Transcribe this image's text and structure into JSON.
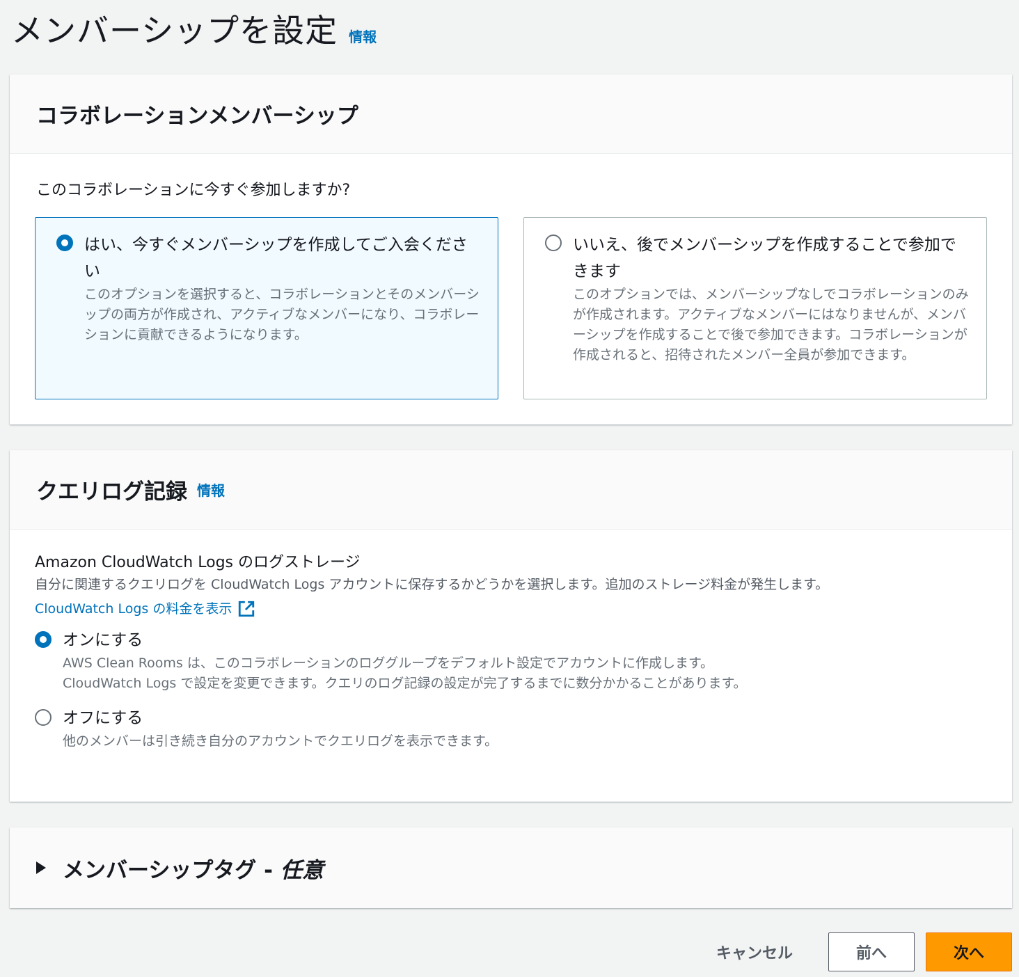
{
  "page": {
    "title": "メンバーシップを設定",
    "info": "情報"
  },
  "membership": {
    "title": "コラボレーションメンバーシップ",
    "question": "このコラボレーションに今すぐ参加しますか?",
    "options": [
      {
        "label": "はい、今すぐメンバーシップを作成してご入会ください",
        "description": "このオプションを選択すると、コラボレーションとそのメンバーシップの両方が作成され、アクティブなメンバーになり、コラボレーションに貢献できるようになります。",
        "selected": true
      },
      {
        "label": "いいえ、後でメンバーシップを作成することで参加できます",
        "description": "このオプションでは、メンバーシップなしでコラボレーションのみが作成されます。アクティブなメンバーにはなりませんが、メンバーシップを作成することで後で参加できます。コラボレーションが作成されると、招待されたメンバー全員が参加できます。",
        "selected": false
      }
    ]
  },
  "query_logging": {
    "title": "クエリログ記録",
    "info": "情報",
    "field_label": "Amazon CloudWatch Logs のログストレージ",
    "field_description": "自分に関連するクエリログを CloudWatch Logs アカウントに保存するかどうかを選択します。追加のストレージ料金が発生します。",
    "pricing_link": "CloudWatch Logs の料金を表示",
    "options": [
      {
        "label": "オンにする",
        "description": "AWS Clean Rooms は、このコラボレーションのロググループをデフォルト設定でアカウントに作成します。CloudWatch Logs で設定を変更できます。クエリのログ記録の設定が完了するまでに数分かかることがあります。",
        "selected": true
      },
      {
        "label": "オフにする",
        "description": "他のメンバーは引き続き自分のアカウントでクエリログを表示できます。",
        "selected": false
      }
    ]
  },
  "tags": {
    "title": "メンバーシップタグ - ",
    "optional": "任意"
  },
  "footer": {
    "cancel": "キャンセル",
    "previous": "前へ",
    "next": "次へ"
  },
  "colors": {
    "accent": "#0073bb",
    "primary_button": "#ff9900",
    "background": "#f2f3f3"
  },
  "icons": {
    "external_link": "external-link-icon",
    "expand": "caret-right-icon"
  }
}
